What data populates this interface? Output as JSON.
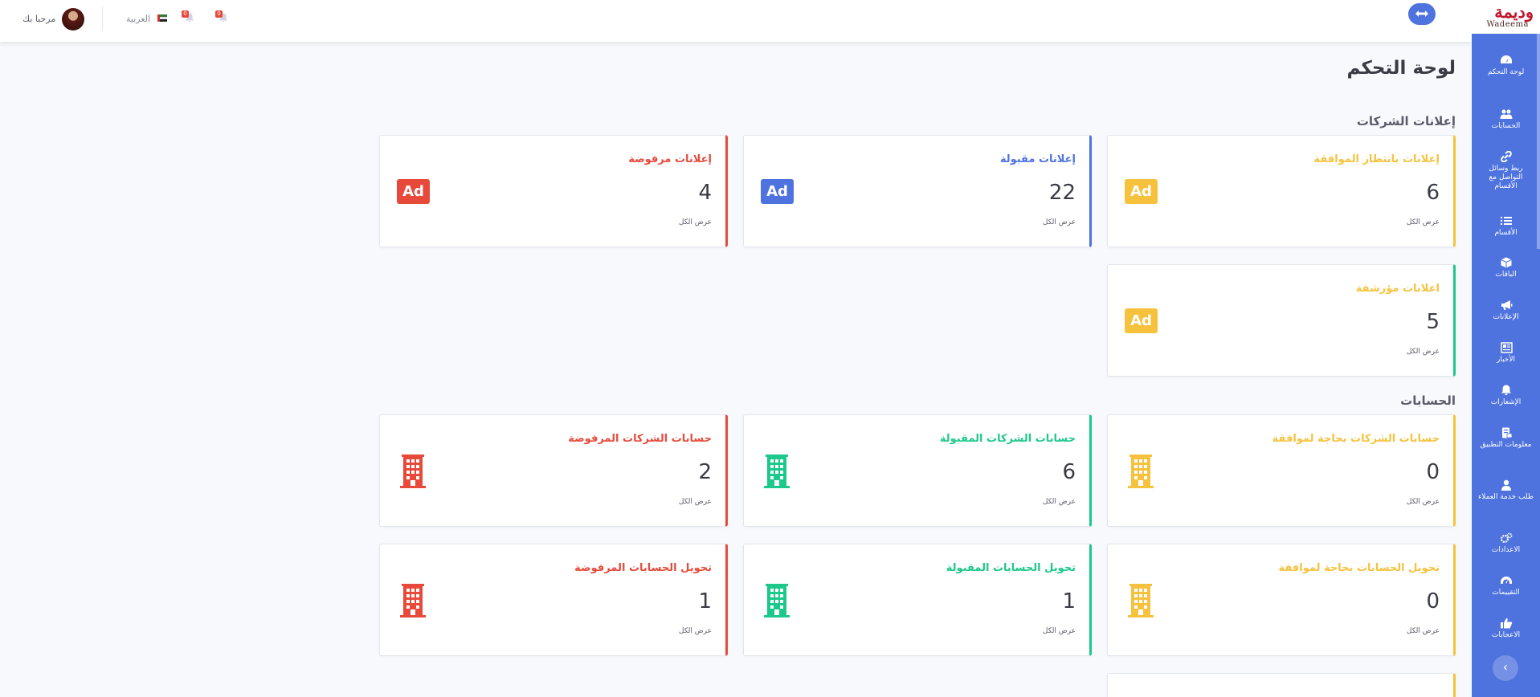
{
  "brand": {
    "logo_arabic": "وديمة",
    "logo_latin": "Wadeema"
  },
  "topbar": {
    "welcome": "مرحبا بك",
    "language": "العربية",
    "notif_count_1": "0",
    "notif_count_2": "0"
  },
  "sidebar": {
    "items": [
      {
        "label": "لوحة التحكم",
        "icon": "dashboard-icon"
      },
      {
        "label": "الحسابات",
        "icon": "users-icon"
      },
      {
        "label": "ربط وسائل التواصل مع الأقسام",
        "icon": "link-icon"
      },
      {
        "label": "الأقسام",
        "icon": "list-icon"
      },
      {
        "label": "الباقات",
        "icon": "box-icon"
      },
      {
        "label": "الإعلانات",
        "icon": "megaphone-icon"
      },
      {
        "label": "الأخبار",
        "icon": "newspaper-icon"
      },
      {
        "label": "الإشعارات",
        "icon": "bell-icon"
      },
      {
        "label": "معلومات التطبيق",
        "icon": "app-info-icon"
      },
      {
        "label": "طلب خدمة العملاء",
        "icon": "support-icon"
      },
      {
        "label": "الاعدادات",
        "icon": "cogs-icon"
      },
      {
        "label": "التقييمات",
        "icon": "rating-icon"
      },
      {
        "label": "الاعجابات",
        "icon": "thumbs-up-icon"
      }
    ]
  },
  "page": {
    "title": "لوحة التحكم",
    "section_ads": "إعلانات الشركات",
    "section_accounts": "الحسابات",
    "view_all": "عرض الكل"
  },
  "ads_cards": [
    {
      "title": "إعلانات بانتظار الموافقة",
      "value": "6",
      "color": "#f6c23e"
    },
    {
      "title": "إعلانات مقبولة",
      "value": "22",
      "color": "#4e73df"
    },
    {
      "title": "إعلانات مرفوضة",
      "value": "4",
      "color": "#e74a3b"
    },
    {
      "title": "اعلانات مؤرشفة",
      "value": "5",
      "color": "#f6c23e"
    }
  ],
  "accounts_cards": [
    {
      "title": "حسابات الشركات بحاجة لموافقة",
      "value": "0",
      "color": "#f6c23e"
    },
    {
      "title": "حسابات الشركات المقبولة",
      "value": "6",
      "color": "#1cc88a"
    },
    {
      "title": "حسابات الشركات المرفوضة",
      "value": "2",
      "color": "#e74a3b"
    },
    {
      "title": "تحويل الحسابات بحاجة لموافقة",
      "value": "0",
      "color": "#f6c23e"
    },
    {
      "title": "تحويل الحسابات المقبولة",
      "value": "1",
      "color": "#1cc88a"
    },
    {
      "title": "تحويل الحسابات المرفوضة",
      "value": "1",
      "color": "#e74a3b"
    }
  ],
  "ad_badge_text": "Ad"
}
